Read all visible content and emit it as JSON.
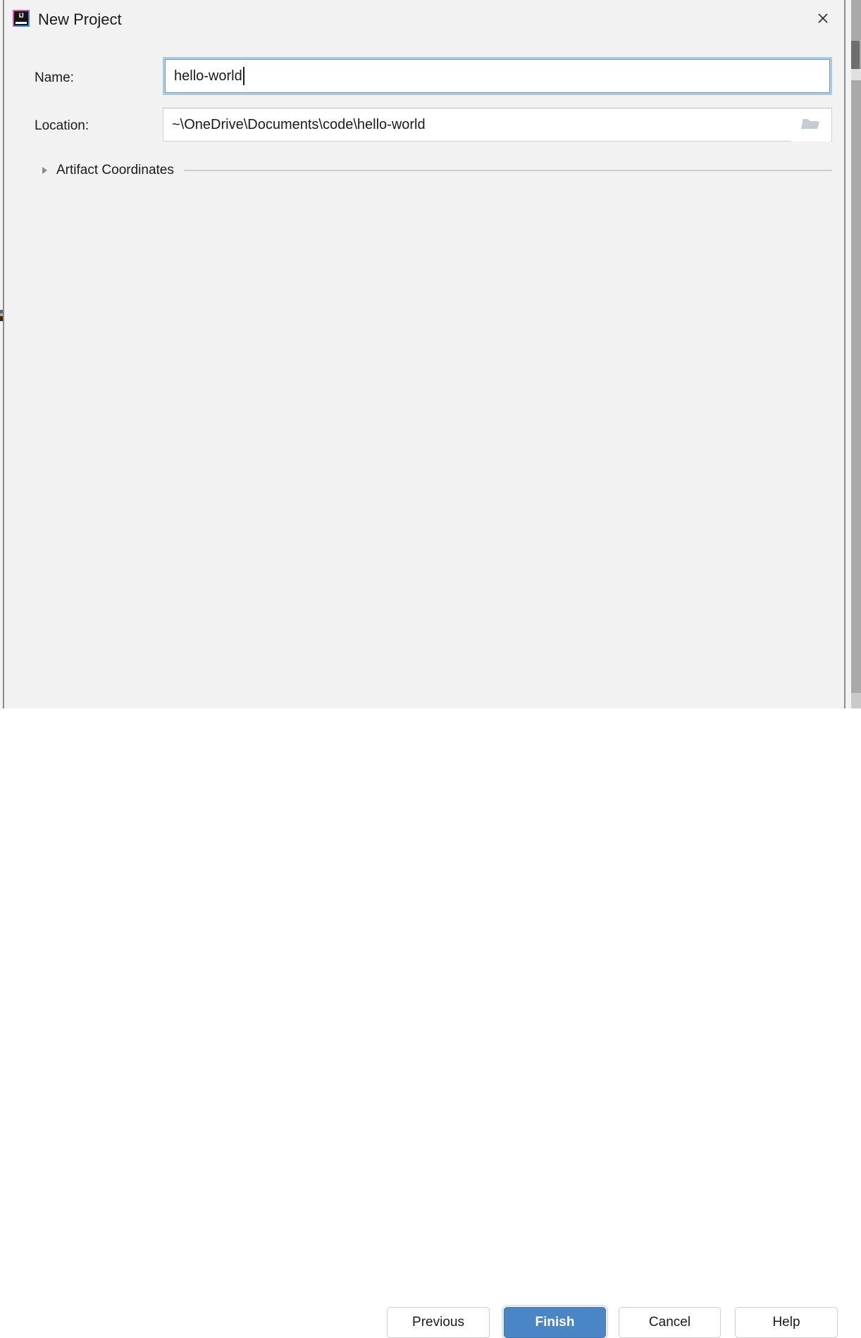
{
  "window": {
    "title": "New Project",
    "app_icon": "intellij-idea-icon",
    "app_icon_letters": "IJ",
    "close_icon": "close-icon"
  },
  "form": {
    "name": {
      "label": "Name:",
      "value": "hello-world",
      "placeholder": "",
      "focused": true
    },
    "location": {
      "label": "Location:",
      "value": "~\\OneDrive\\Documents\\code\\hello-world",
      "placeholder": "",
      "browse_icon": "folder-icon"
    }
  },
  "sections": {
    "artifact_coordinates": {
      "label": "Artifact Coordinates",
      "expanded": false,
      "arrow_icon": "chevron-right-icon"
    }
  },
  "buttons": {
    "previous": "Previous",
    "finish": "Finish",
    "cancel": "Cancel",
    "help": "Help"
  },
  "colors": {
    "dialog_background": "#f2f2f2",
    "primary_button": "#4a86c5",
    "focus_ring": "#a9cbea",
    "text": "#1a1a1a",
    "separator": "#cfcfcf"
  }
}
